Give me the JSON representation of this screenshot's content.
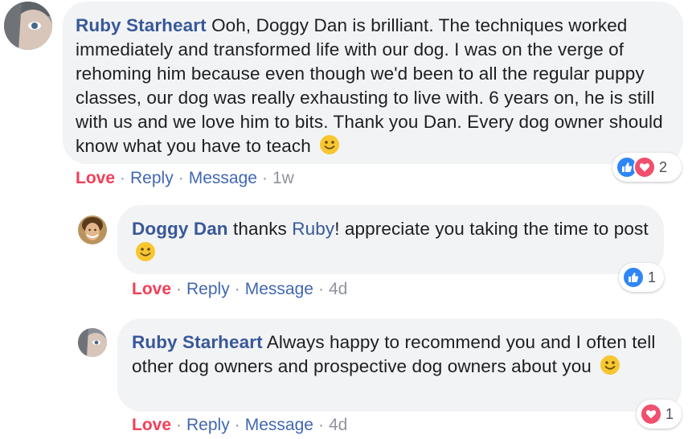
{
  "comments": [
    {
      "author": "Ruby Starheart",
      "text": "Ooh, Doggy Dan is brilliant. The techniques worked immediately and transformed life with our dog. I was on the verge of rehoming him because even though we'd been to all the regular puppy classes, our dog was really exhausting to live with. 6 years on, he is still with us and we love him to bits. Thank you Dan. Every dog owner should know what you have to teach",
      "emoji": "slightly-smiling-face",
      "actions": {
        "love": "Love",
        "reply": "Reply",
        "message": "Message",
        "time": "1w"
      },
      "reactions": {
        "icons": [
          "like-icon",
          "love-icon"
        ],
        "count": "2"
      }
    },
    {
      "author": "Doggy Dan",
      "text_pre": "thanks ",
      "mention": "Ruby",
      "text_post": "! appreciate you taking the time to post",
      "emoji": "slightly-smiling-face",
      "actions": {
        "love": "Love",
        "reply": "Reply",
        "message": "Message",
        "time": "4d"
      },
      "reactions": {
        "icons": [
          "like-icon"
        ],
        "count": "1"
      }
    },
    {
      "author": "Ruby Starheart",
      "text": "Always happy to recommend you and I often tell other dog owners and prospective dog owners about you",
      "emoji": "slightly-smiling-face",
      "actions": {
        "love": "Love",
        "reply": "Reply",
        "message": "Message",
        "time": "4d"
      },
      "reactions": {
        "icons": [
          "love-icon"
        ],
        "count": "1"
      }
    }
  ],
  "colors": {
    "name": "#385898",
    "link": "#4267b2",
    "love": "#f33e58",
    "meta": "#90949c",
    "bubble": "#f2f3f5",
    "like_reaction": "#2f86f6",
    "love_reaction": "#f0506e",
    "emoji": "#f7c731"
  }
}
